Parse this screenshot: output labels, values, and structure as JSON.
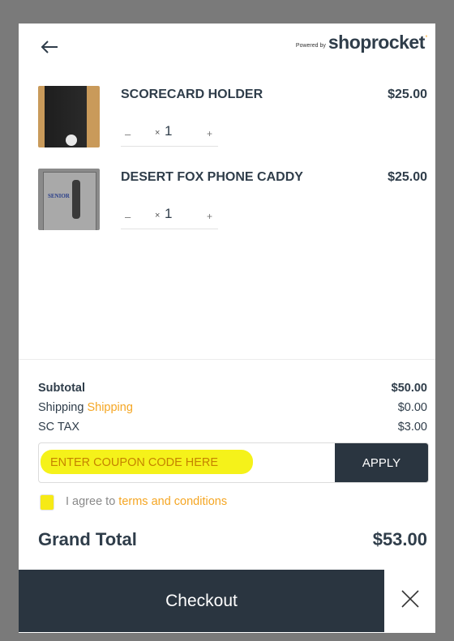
{
  "header": {
    "back_icon": "arrow-left-icon",
    "powered_by": "Powered by",
    "brand": "shoprocket",
    "brand_mark": "'"
  },
  "items": [
    {
      "name": "SCORECARD HOLDER",
      "price": "$25.00",
      "quantity": "1",
      "minus": "–",
      "plus": "+",
      "remove": "×"
    },
    {
      "name": "DESERT FOX PHONE CADDY",
      "price": "$25.00",
      "quantity": "1",
      "minus": "–",
      "plus": "+",
      "remove": "×"
    }
  ],
  "thumb_text": "SENIOR",
  "totals": {
    "subtotal_label": "Subtotal",
    "subtotal_value": "$50.00",
    "shipping_label": "Shipping",
    "shipping_link": "Shipping",
    "shipping_value": "$0.00",
    "tax_label": "SC TAX",
    "tax_value": "$3.00"
  },
  "coupon": {
    "placeholder": "ENTER COUPON CODE HERE",
    "apply_label": "APPLY"
  },
  "agree": {
    "prefix": "I agree to ",
    "link": "terms and conditions"
  },
  "grand_total": {
    "label": "Grand Total",
    "value": "$53.00"
  },
  "checkout_label": "Checkout",
  "colors": {
    "accent": "#f5a623",
    "dark": "#2a3540",
    "highlight": "#f5f21a"
  }
}
